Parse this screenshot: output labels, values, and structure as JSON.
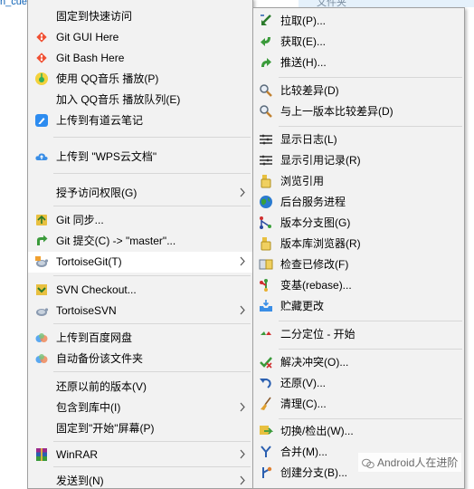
{
  "background": {
    "file_fragment": "n_cue",
    "top_item": "文件夹"
  },
  "main_menu": {
    "items": [
      {
        "label": "固定到快速访问",
        "icon": "none-icon"
      },
      {
        "label": "Git GUI Here",
        "icon": "git-gui-icon"
      },
      {
        "label": "Git Bash Here",
        "icon": "git-bash-icon"
      },
      {
        "label": "使用 QQ音乐 播放(P)",
        "icon": "qqmusic-icon"
      },
      {
        "label": "加入 QQ音乐 播放队列(E)",
        "icon": "none-icon"
      },
      {
        "label": "上传到有道云笔记",
        "icon": "youdao-note-icon"
      },
      {
        "label": "上传到 \"WPS云文档\"",
        "icon": "wps-cloud-icon"
      },
      {
        "label": "授予访问权限(G)",
        "icon": "none-icon"
      },
      {
        "label": "Git 同步...",
        "icon": "git-sync-icon"
      },
      {
        "label": "Git 提交(C) -> \"master\"...",
        "icon": "git-commit-icon"
      },
      {
        "label": "TortoiseGit(T)",
        "icon": "tortoisegit-icon"
      },
      {
        "label": "SVN Checkout...",
        "icon": "svn-checkout-icon"
      },
      {
        "label": "TortoiseSVN",
        "icon": "tortoisesvn-icon"
      },
      {
        "label": "上传到百度网盘",
        "icon": "baidu-netdisk-icon"
      },
      {
        "label": "自动备份该文件夹",
        "icon": "baidu-backup-icon"
      },
      {
        "label": "还原以前的版本(V)",
        "icon": "none-icon"
      },
      {
        "label": "包含到库中(I)",
        "icon": "none-icon"
      },
      {
        "label": "固定到\"开始\"屏幕(P)",
        "icon": "none-icon"
      },
      {
        "label": "WinRAR",
        "icon": "winrar-icon"
      },
      {
        "label": "发送到(N)",
        "icon": "none-icon"
      }
    ]
  },
  "sub_menu": {
    "items": [
      {
        "label": "拉取(P)...",
        "icon": "pull-icon"
      },
      {
        "label": "获取(E)...",
        "icon": "fetch-icon"
      },
      {
        "label": "推送(H)...",
        "icon": "push-icon"
      },
      {
        "label": "比较差异(D)",
        "icon": "diff-icon"
      },
      {
        "label": "与上一版本比较差异(D)",
        "icon": "diff-previous-icon"
      },
      {
        "label": "显示日志(L)",
        "icon": "show-log-icon"
      },
      {
        "label": "显示引用记录(R)",
        "icon": "reflog-icon"
      },
      {
        "label": "浏览引用",
        "icon": "browse-refs-icon"
      },
      {
        "label": "后台服务进程",
        "icon": "daemon-icon"
      },
      {
        "label": "版本分支图(G)",
        "icon": "revision-graph-icon"
      },
      {
        "label": "版本库浏览器(R)",
        "icon": "repo-browser-icon"
      },
      {
        "label": "检查已修改(F)",
        "icon": "check-modifications-icon"
      },
      {
        "label": "变基(rebase)...",
        "icon": "rebase-icon"
      },
      {
        "label": "贮藏更改",
        "icon": "stash-icon"
      },
      {
        "label": "二分定位 - 开始",
        "icon": "bisect-icon"
      },
      {
        "label": "解决冲突(O)...",
        "icon": "resolve-icon"
      },
      {
        "label": "还原(V)...",
        "icon": "revert-icon"
      },
      {
        "label": "清理(C)...",
        "icon": "cleanup-icon"
      },
      {
        "label": "切换/检出(W)...",
        "icon": "switch-icon"
      },
      {
        "label": "合并(M)...",
        "icon": "merge-icon"
      },
      {
        "label": "创建分支(B)...",
        "icon": "create-branch-icon"
      }
    ]
  },
  "watermark": {
    "text": "Android人在进阶"
  }
}
